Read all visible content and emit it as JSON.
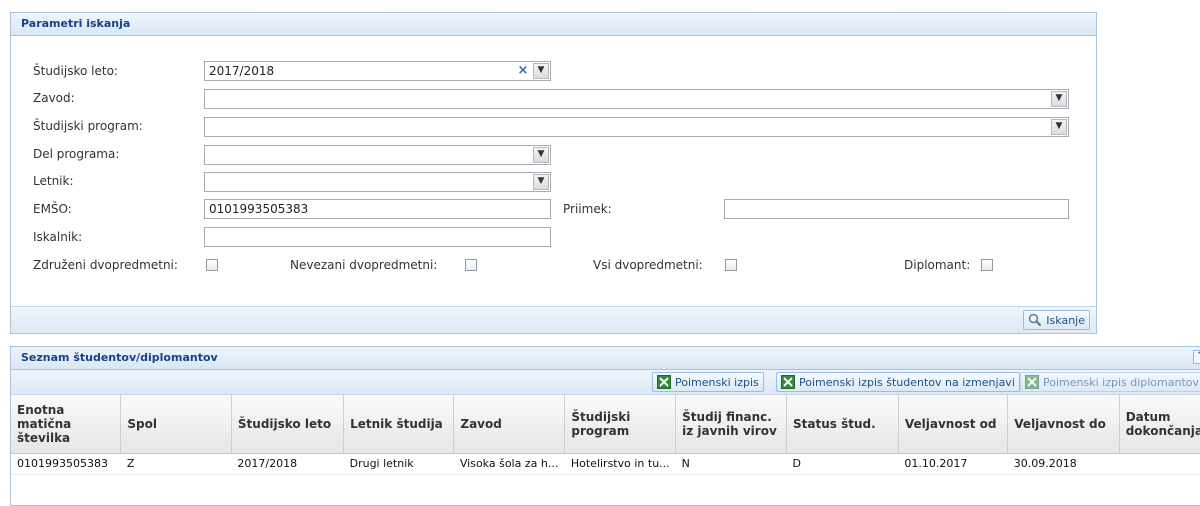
{
  "search": {
    "title": "Parametri iskanja",
    "labels": {
      "studijsko_leto": "Študijsko leto:",
      "zavod": "Zavod:",
      "studijski_program": "Študijski program:",
      "del_programa": "Del programa:",
      "letnik": "Letnik:",
      "emso": "EMŠO:",
      "priimek": "Priimek:",
      "iskalnik": "Iskalnik:"
    },
    "values": {
      "studijsko_leto": "2017/2018",
      "zavod": "",
      "studijski_program": "",
      "del_programa": "",
      "letnik": "",
      "emso": "0101993505383",
      "priimek": "",
      "iskalnik": ""
    },
    "checkboxes": {
      "zdruzeni": "Združeni dvopredmetni:",
      "nevezani": "Nevezani dvopredmetni:",
      "vsi": "Vsi dvopredmetni:",
      "diplomant": "Diplomant:"
    },
    "search_button": "Iskanje"
  },
  "list": {
    "title": "Seznam študentov/diplomantov",
    "buttons": {
      "poimenski_izpis": "Poimenski izpis",
      "izpis_na_izmenjavi": "Poimenski izpis študentov na izmenjavi",
      "izpis_diplomantov": "Poimenski izpis diplomantov"
    },
    "columns": [
      "Enotna matična številka",
      "Spol",
      "Študijsko leto",
      "Letnik študija",
      "Zavod",
      "Študijski program",
      "Študij financ. iz javnih virov",
      "Status štud.",
      "Veljavnost od",
      "Veljavnost do",
      "Datum dokončanja"
    ],
    "rows": [
      [
        "0101993505383",
        "Z",
        "2017/2018",
        "Drugi letnik",
        "Visoka šola za h...",
        "Hotelirstvo in tu...",
        "N",
        "D",
        "01.10.2017",
        "30.09.2018",
        ""
      ]
    ]
  },
  "colors": {
    "header_text": "#15428b",
    "border": "#a9c3db",
    "clear_icon": "#2b6cbf"
  }
}
